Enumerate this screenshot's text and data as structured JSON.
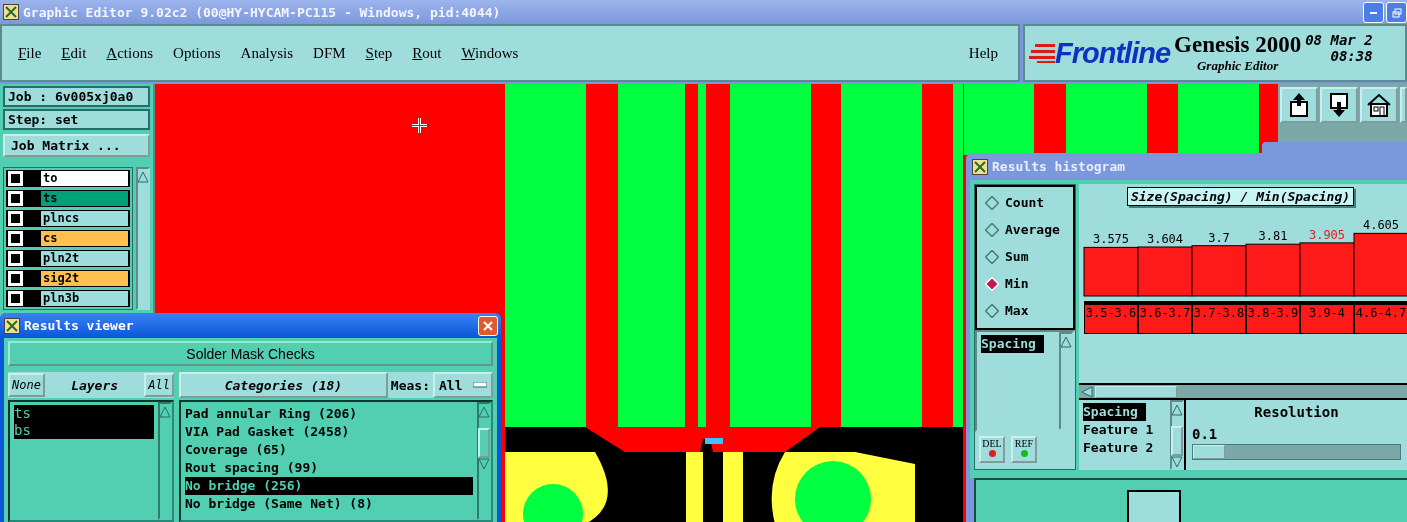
{
  "window": {
    "title": "Graphic Editor 9.02c2 (00@HY-HYCAM-PC115 - Windows, pid:4044)"
  },
  "menu": [
    {
      "label": "File",
      "underlined": true
    },
    {
      "label": "Edit",
      "underlined": true
    },
    {
      "label": "Actions",
      "underlined": true
    },
    {
      "label": "Options",
      "underlined": false
    },
    {
      "label": "Analysis",
      "underlined": false
    },
    {
      "label": "DFM",
      "underlined": false
    },
    {
      "label": "Step",
      "underlined": true
    },
    {
      "label": "Rout",
      "underlined": true
    },
    {
      "label": "Windows",
      "underlined": true
    }
  ],
  "help": "Help",
  "brand": {
    "logo": "Frontline",
    "product": "Genesis 2000",
    "subtitle": "Graphic Editor",
    "date": "08 Mar 2",
    "time": "08:38"
  },
  "job_panel": {
    "job": "Job : 6v005xj0a0",
    "step": "Step: set",
    "matrix_button": "Job Matrix ...",
    "layers": [
      {
        "name": "to",
        "color": "#ffffff",
        "checked": false
      },
      {
        "name": "ts",
        "color": "#00a078",
        "checked": false
      },
      {
        "name": "plncs",
        "color": "#9fdcdc",
        "checked": false
      },
      {
        "name": "cs",
        "color": "#ffc050",
        "checked": false
      },
      {
        "name": "pln2t",
        "color": "#9fdcdc",
        "checked": false
      },
      {
        "name": "sig2t",
        "color": "#ffc050",
        "checked": false
      },
      {
        "name": "pln3b",
        "color": "#9fdcdc",
        "checked": false
      }
    ]
  },
  "results_viewer": {
    "title": "Results viewer",
    "checks_button": "Solder Mask Checks",
    "none_button": "None",
    "layers_label": "Layers",
    "all_button": "All",
    "layers": [
      {
        "name": "ts",
        "selected": true
      },
      {
        "name": "bs",
        "selected": true
      }
    ],
    "categories_button": "Categories (18)",
    "meas_label": "Meas:",
    "meas_value": "All",
    "categories": [
      {
        "label": "Pad annular Ring (206)",
        "selected": false
      },
      {
        "label": "VIA Pad Gasket (2458)",
        "selected": false
      },
      {
        "label": "Coverage (65)",
        "selected": false
      },
      {
        "label": "Rout spacing (99)",
        "selected": false
      },
      {
        "label": "No bridge (256)",
        "selected": true
      },
      {
        "label": "No bridge (Same Net) (8)",
        "selected": false
      }
    ]
  },
  "histogram": {
    "title": "Results histogram",
    "modes": [
      {
        "label": "Count",
        "selected": false
      },
      {
        "label": "Average",
        "selected": false
      },
      {
        "label": "Sum",
        "selected": false
      },
      {
        "label": "Min",
        "selected": true
      },
      {
        "label": "Max",
        "selected": false
      }
    ],
    "measures": [
      {
        "label": "Spacing",
        "selected": true
      }
    ],
    "actions": [
      {
        "label": "DEL",
        "color": "#e02020"
      },
      {
        "label": "REF",
        "color": "#10c020"
      }
    ],
    "chart_data": {
      "type": "bar",
      "title": "Size(Spacing) / Min(Spacing)",
      "categories": [
        "3.5-3.6",
        "3.6-3.7",
        "3.7-3.8",
        "3.8-3.9",
        "3.9-4",
        "4.6-4.7"
      ],
      "values": [
        3.575,
        3.604,
        3.7,
        3.81,
        3.905,
        4.605
      ],
      "data_labels": true
    },
    "highlighted_bins": [
      false,
      false,
      false,
      false,
      true,
      false
    ],
    "fields": [
      {
        "label": "Spacing",
        "selected": true
      },
      {
        "label": "Feature 1",
        "selected": false
      },
      {
        "label": "Feature 2",
        "selected": false
      }
    ],
    "resolution": {
      "label": "Resolution",
      "value": "0.1",
      "level": 0
    }
  }
}
